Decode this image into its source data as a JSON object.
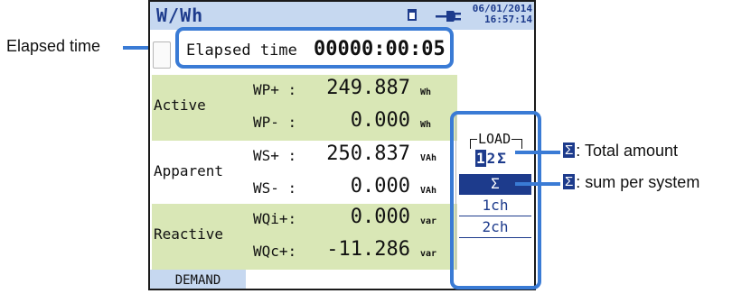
{
  "screen": {
    "title": "W/Wh",
    "date": "06/01/2014",
    "time": "16:57:14",
    "icons": [
      "sd-card-icon",
      "power-plug-icon"
    ]
  },
  "elapsed": {
    "label": "Elapsed time",
    "value": "00000:00:05"
  },
  "groups": [
    {
      "name": "Active",
      "rows": [
        {
          "label": "WP+ :",
          "value": "249.887",
          "unit": "Wh"
        },
        {
          "label": "WP- :",
          "value": "0.000",
          "unit": "Wh"
        }
      ]
    },
    {
      "name": "Apparent",
      "rows": [
        {
          "label": "WS+ :",
          "value": "250.837",
          "unit": "VAh"
        },
        {
          "label": "WS- :",
          "value": "0.000",
          "unit": "VAh"
        }
      ]
    },
    {
      "name": "Reactive",
      "rows": [
        {
          "label": "WQi+:",
          "value": "0.000",
          "unit": "var"
        },
        {
          "label": "WQc+:",
          "value": "-11.286",
          "unit": "var"
        }
      ]
    }
  ],
  "load": {
    "title": "LOAD",
    "options": [
      "1",
      "2",
      "Σ"
    ],
    "active_option": "1",
    "buttons": [
      "Σ",
      "1ch",
      "2ch"
    ],
    "selected_button": "Σ"
  },
  "footer": {
    "demand_label": "DEMAND"
  },
  "callouts": {
    "elapsed": "Elapsed time",
    "total_sigma": "Σ",
    "total_text": ": Total amount",
    "sum_sigma": "Σ",
    "sum_text": ": sum per system"
  },
  "colors": {
    "accent": "#3a7bd5",
    "navy": "#1d3b8c",
    "titlebar": "#c6d8f0",
    "shaded_row": "#d9e7b6"
  }
}
